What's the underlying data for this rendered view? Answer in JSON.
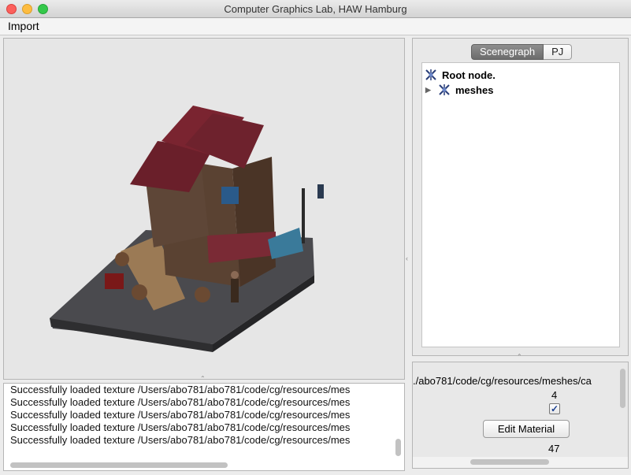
{
  "window": {
    "title": "Computer Graphics Lab, HAW Hamburg"
  },
  "menu": {
    "items": [
      "Import"
    ]
  },
  "console": {
    "lines": [
      "Successfully loaded texture /Users/abo781/abo781/code/cg/resources/mes",
      "Successfully loaded texture /Users/abo781/abo781/code/cg/resources/mes",
      "Successfully loaded texture /Users/abo781/abo781/code/cg/resources/mes",
      "Successfully loaded texture /Users/abo781/abo781/code/cg/resources/mes",
      "Successfully loaded texture /Users/abo781/abo781/code/cg/resources/mes"
    ]
  },
  "tabs": [
    {
      "label": "Scenegraph",
      "active": true
    },
    {
      "label": "PJ",
      "active": false
    }
  ],
  "tree": {
    "root": {
      "label": "Root node.",
      "icon": "scene-node-icon"
    },
    "children": [
      {
        "label": "meshes",
        "icon": "scene-node-icon",
        "expanded": false
      }
    ]
  },
  "properties": {
    "path": "./abo781/code/cg/resources/meshes/ca",
    "count_a": "4",
    "checkbox_checked": true,
    "edit_material_label": "Edit Material",
    "count_b": "47"
  }
}
